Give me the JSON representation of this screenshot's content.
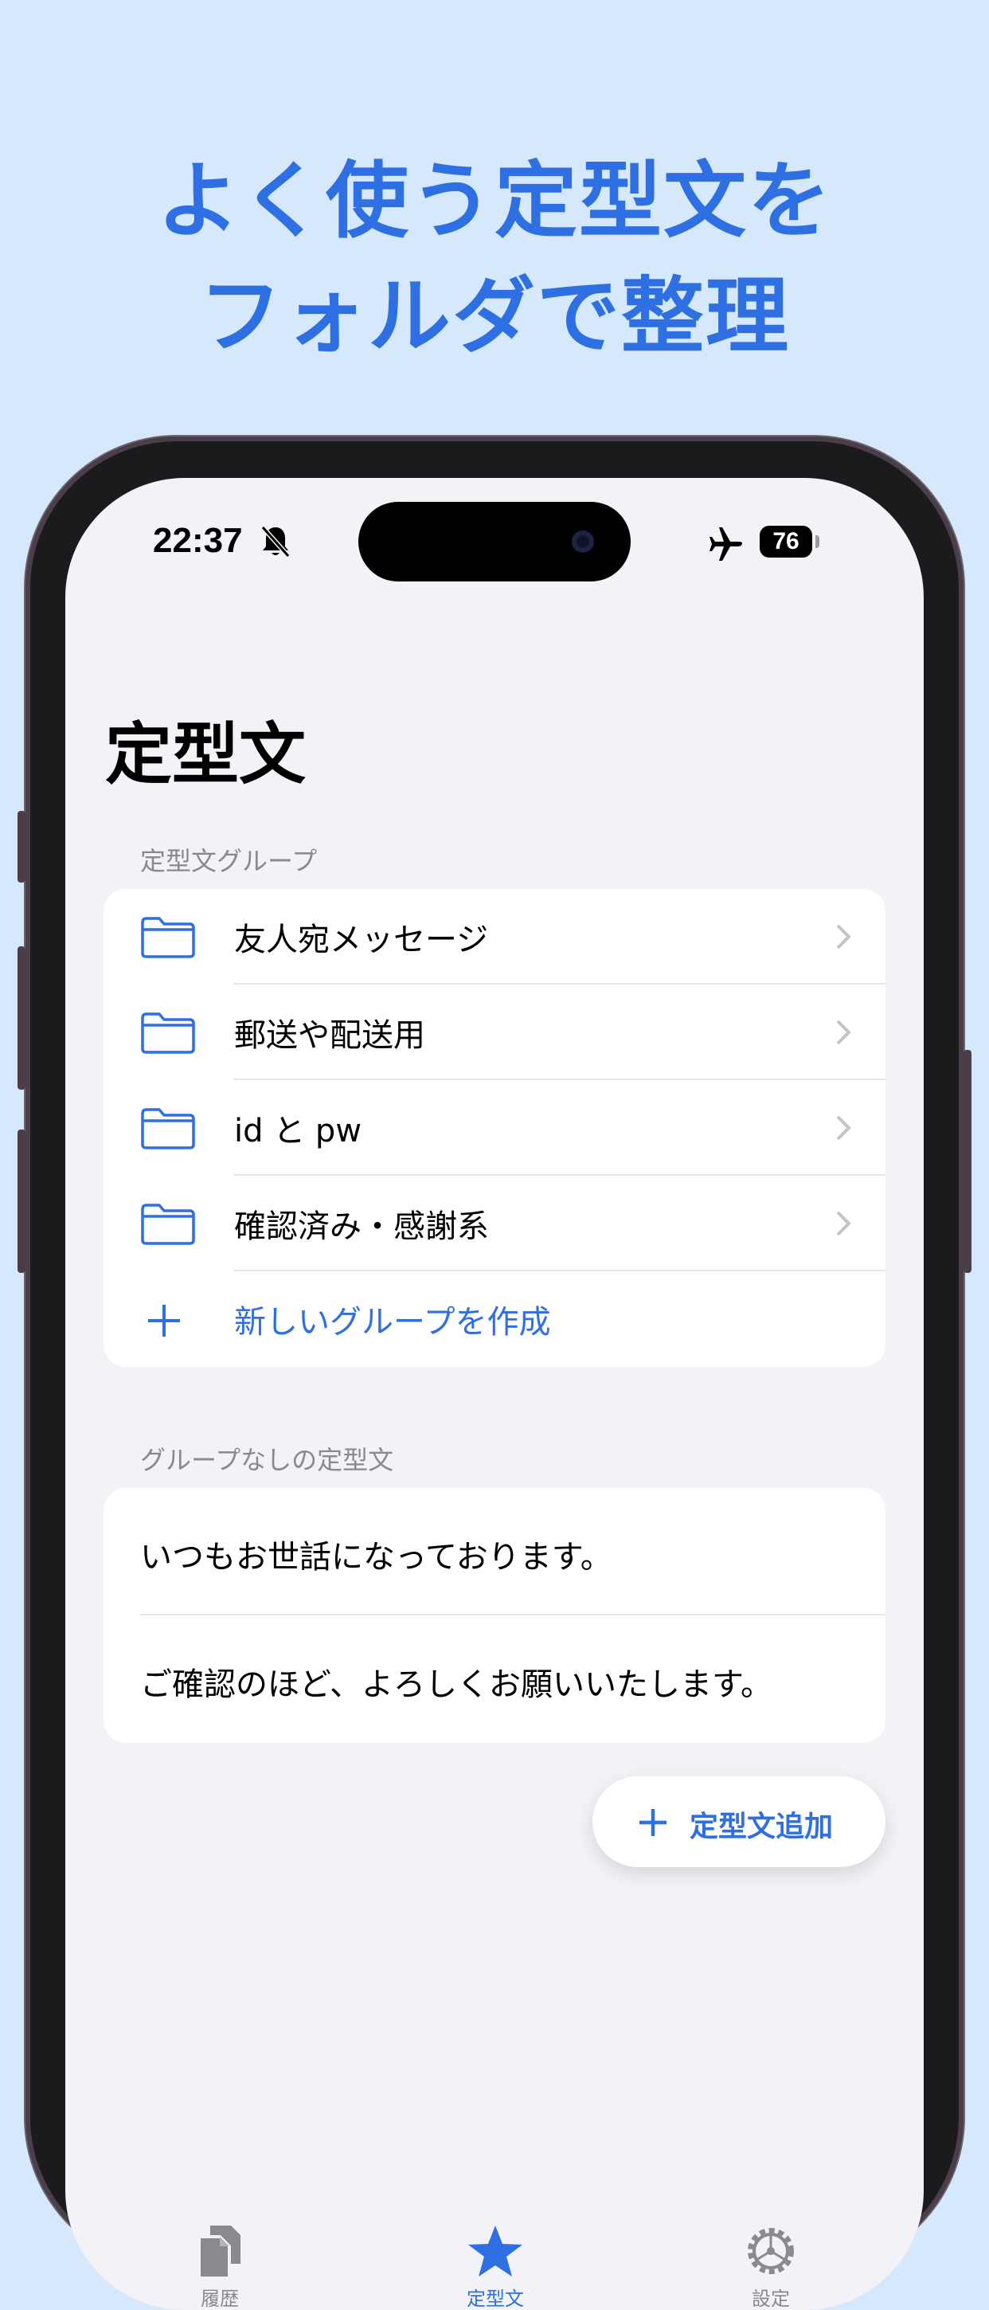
{
  "headline": {
    "line1": "よく使う定型文を",
    "line2": "フォルダで整理"
  },
  "status_bar": {
    "time": "22:37",
    "battery": "76"
  },
  "page_title": "定型文",
  "groups": {
    "header": "定型文グループ",
    "items": [
      {
        "label": "友人宛メッセージ"
      },
      {
        "label": "郵送や配送用"
      },
      {
        "label": "id と pw"
      },
      {
        "label": "確認済み・感謝系"
      }
    ],
    "create_label": "新しいグループを作成"
  },
  "ungrouped": {
    "header": "グループなしの定型文",
    "items": [
      {
        "label": "いつもお世話になっております。"
      },
      {
        "label": "ご確認のほど、よろしくお願いいたします。"
      }
    ]
  },
  "fab": {
    "label": "定型文追加"
  },
  "tabbar": {
    "tabs": [
      {
        "label": "履歴",
        "icon": "document-copy-icon"
      },
      {
        "label": "定型文",
        "icon": "star-icon",
        "active": true
      },
      {
        "label": "設定",
        "icon": "gear-icon"
      }
    ]
  },
  "colors": {
    "accent": "#2f6fe4",
    "background": "#d6e8fb",
    "screen": "#f2f2f7"
  }
}
